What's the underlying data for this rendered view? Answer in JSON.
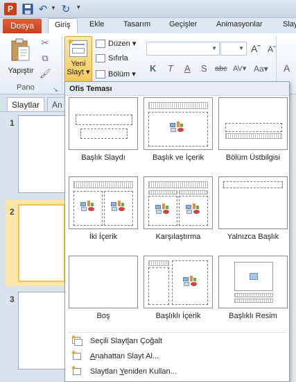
{
  "qat": {
    "app_icon_letter": "P"
  },
  "tabs": {
    "file": "Dosya",
    "items": [
      "Giriş",
      "Ekle",
      "Tasarım",
      "Geçişler",
      "Animasyonlar",
      "Slay"
    ]
  },
  "ribbon": {
    "paste_label": "Yapıştır",
    "clipboard_group": "Pano",
    "new_slide_line1": "Yeni",
    "new_slide_line2": "Slayt",
    "layout_cmd": "Düzen",
    "reset_cmd": "Sıfırla",
    "section_cmd": "Bölüm",
    "grow_font": "A",
    "shrink_font": "A",
    "bold": "K",
    "italic": "T",
    "underline": "A",
    "shadow": "S",
    "strike": "abc",
    "spacing": "AV",
    "case": "Aa",
    "font_color": "A"
  },
  "left_pane": {
    "tab_slides": "Slaytlar",
    "tab_outline": "An",
    "slide_numbers": [
      "1",
      "2",
      "3"
    ]
  },
  "gallery": {
    "header": "Ofis Teması",
    "layouts": [
      "Başlık Slaydı",
      "Başlık ve İçerik",
      "Bölüm Üstbilgisi",
      "İki İçerik",
      "Karşılaştırma",
      "Yalnızca Başlık",
      "Boş",
      "Başlıklı İçerik",
      "Başlıklı Resim"
    ],
    "menu": {
      "duplicate_pre": "Seçili Slayt",
      "duplicate_u": "l",
      "duplicate_post": "arı Çoğalt",
      "outline_u": "A",
      "outline_post": "nahattan Slayt Al...",
      "reuse_pre": "Slaytları ",
      "reuse_u": "Y",
      "reuse_post": "eniden Kullan..."
    }
  },
  "colors": {
    "file_tab": "#c7421c",
    "new_slide_highlight": "#f8c85c",
    "selected_thumb": "#f3c24e"
  }
}
